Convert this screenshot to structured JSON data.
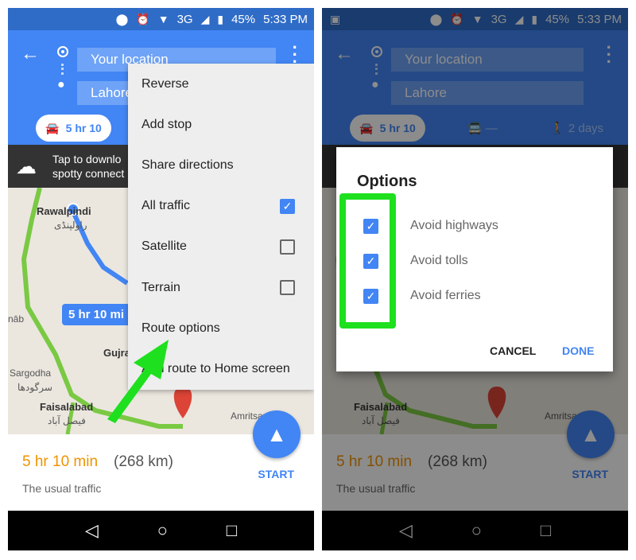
{
  "status_bar": {
    "battery": "45%",
    "time": "5:33 PM",
    "network": "3G"
  },
  "directions": {
    "origin": "Your location",
    "destination": "Lahore",
    "modes": {
      "drive": "5 hr 10",
      "transit": "—",
      "walk": "2 days"
    }
  },
  "offline_banner": {
    "line1": "Tap to downlo",
    "line2": "spotty connect"
  },
  "map": {
    "labels": [
      "Rawalpindi",
      "راولپنڈی",
      "Gujra",
      "Sargodha",
      "سرگودھا",
      "Faisalabad",
      "فیصل آباد",
      "Amritsar",
      "nāb"
    ],
    "route_badge": "5 hr 10 mi"
  },
  "summary": {
    "duration": "5 hr 10 min",
    "distance": "(268 km)",
    "traffic": "The usual traffic",
    "start_label": "START"
  },
  "menu": {
    "items": [
      {
        "label": "Reverse",
        "checkbox": null
      },
      {
        "label": "Add stop",
        "checkbox": null
      },
      {
        "label": "Share directions",
        "checkbox": null
      },
      {
        "label": "All traffic",
        "checkbox": true
      },
      {
        "label": "Satellite",
        "checkbox": false
      },
      {
        "label": "Terrain",
        "checkbox": false
      },
      {
        "label": "Route options",
        "checkbox": null
      },
      {
        "label": "Add route to Home screen",
        "checkbox": null
      }
    ]
  },
  "options_dialog": {
    "title": "Options",
    "options": [
      {
        "label": "Avoid highways",
        "checked": true
      },
      {
        "label": "Avoid tolls",
        "checked": true
      },
      {
        "label": "Avoid ferries",
        "checked": true
      }
    ],
    "cancel": "CANCEL",
    "done": "DONE"
  },
  "colors": {
    "accent": "#4285f4",
    "duration": "#f09300",
    "highlight": "#1ee01e"
  }
}
